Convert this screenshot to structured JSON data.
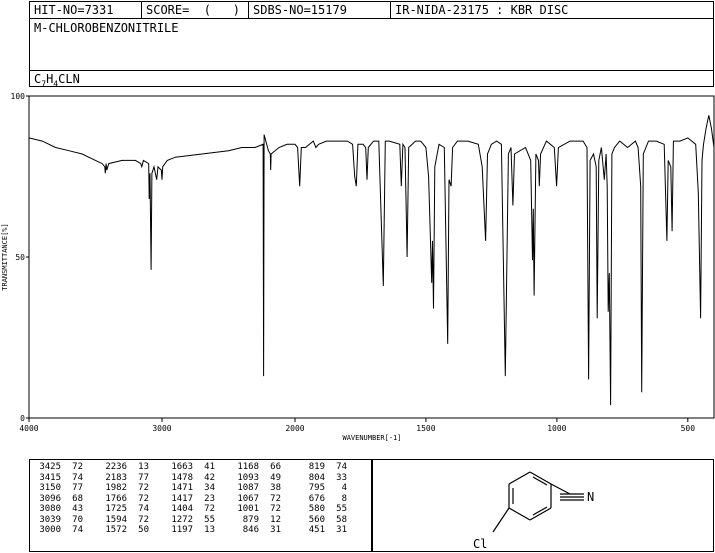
{
  "header": {
    "hit_no": "HIT-NO=7331",
    "score": "SCORE=  (   )",
    "sdbs_no": "SDBS-NO=15179",
    "ir_info": "IR-NIDA-23175 : KBR DISC",
    "compound_name": "M-CHLOROBENZONITRILE",
    "formula": {
      "c": "C",
      "c_sub": "7",
      "h": "H",
      "h_sub": "4",
      "rest": "CLN"
    }
  },
  "chart_data": {
    "type": "line",
    "xlabel": "WAVENUMBER[-1]",
    "ylabel": "TRANSMITTANCE[%]",
    "xlim": [
      4000,
      400
    ],
    "ylim": [
      0,
      100
    ],
    "x_ticks": [
      "4000",
      "3000",
      "2000",
      "1500",
      "1000",
      "500"
    ],
    "y_ticks": [
      "100",
      "50",
      "0"
    ],
    "series": [
      {
        "points": [
          [
            4000,
            87
          ],
          [
            3900,
            86
          ],
          [
            3800,
            84
          ],
          [
            3700,
            83
          ],
          [
            3600,
            82
          ],
          [
            3500,
            80
          ],
          [
            3450,
            79
          ],
          [
            3430,
            78
          ],
          [
            3426,
            76
          ],
          [
            3420,
            79
          ],
          [
            3415,
            77
          ],
          [
            3400,
            79
          ],
          [
            3300,
            80
          ],
          [
            3200,
            80
          ],
          [
            3160,
            79
          ],
          [
            3152,
            78
          ],
          [
            3140,
            80
          ],
          [
            3100,
            79
          ],
          [
            3096,
            68
          ],
          [
            3090,
            76
          ],
          [
            3082,
            46
          ],
          [
            3076,
            76
          ],
          [
            3060,
            78
          ],
          [
            3040,
            74
          ],
          [
            3030,
            78
          ],
          [
            3005,
            77
          ],
          [
            3000,
            74
          ],
          [
            2995,
            78
          ],
          [
            2960,
            80
          ],
          [
            2900,
            81
          ],
          [
            2700,
            82
          ],
          [
            2500,
            83
          ],
          [
            2400,
            84
          ],
          [
            2300,
            84
          ],
          [
            2240,
            85
          ],
          [
            2236,
            13
          ],
          [
            2232,
            88
          ],
          [
            2200,
            83
          ],
          [
            2186,
            82
          ],
          [
            2183,
            77
          ],
          [
            2180,
            82
          ],
          [
            2120,
            84
          ],
          [
            2060,
            85
          ],
          [
            2000,
            85
          ],
          [
            1990,
            84
          ],
          [
            1982,
            72
          ],
          [
            1976,
            84
          ],
          [
            1960,
            84
          ],
          [
            1930,
            86
          ],
          [
            1920,
            84
          ],
          [
            1910,
            85
          ],
          [
            1880,
            86
          ],
          [
            1850,
            86
          ],
          [
            1800,
            86
          ],
          [
            1780,
            85
          ],
          [
            1772,
            75
          ],
          [
            1766,
            72
          ],
          [
            1760,
            85
          ],
          [
            1740,
            85
          ],
          [
            1730,
            84
          ],
          [
            1725,
            74
          ],
          [
            1720,
            84
          ],
          [
            1700,
            86
          ],
          [
            1680,
            86
          ],
          [
            1663,
            41
          ],
          [
            1655,
            86
          ],
          [
            1640,
            86
          ],
          [
            1600,
            85
          ],
          [
            1594,
            72
          ],
          [
            1588,
            85
          ],
          [
            1580,
            84
          ],
          [
            1572,
            50
          ],
          [
            1566,
            84
          ],
          [
            1540,
            86
          ],
          [
            1520,
            86
          ],
          [
            1500,
            84
          ],
          [
            1490,
            75
          ],
          [
            1478,
            42
          ],
          [
            1475,
            55
          ],
          [
            1471,
            34
          ],
          [
            1466,
            78
          ],
          [
            1450,
            85
          ],
          [
            1430,
            84
          ],
          [
            1417,
            23
          ],
          [
            1412,
            74
          ],
          [
            1404,
            72
          ],
          [
            1398,
            84
          ],
          [
            1380,
            86
          ],
          [
            1340,
            86
          ],
          [
            1300,
            85
          ],
          [
            1285,
            78
          ],
          [
            1272,
            55
          ],
          [
            1265,
            82
          ],
          [
            1250,
            85
          ],
          [
            1230,
            86
          ],
          [
            1212,
            85
          ],
          [
            1197,
            13
          ],
          [
            1185,
            82
          ],
          [
            1175,
            84
          ],
          [
            1168,
            66
          ],
          [
            1162,
            82
          ],
          [
            1120,
            84
          ],
          [
            1100,
            80
          ],
          [
            1093,
            49
          ],
          [
            1090,
            65
          ],
          [
            1087,
            38
          ],
          [
            1080,
            82
          ],
          [
            1070,
            80
          ],
          [
            1067,
            72
          ],
          [
            1062,
            82
          ],
          [
            1040,
            86
          ],
          [
            1010,
            84
          ],
          [
            1001,
            72
          ],
          [
            994,
            84
          ],
          [
            950,
            86
          ],
          [
            900,
            86
          ],
          [
            885,
            84
          ],
          [
            879,
            12
          ],
          [
            873,
            80
          ],
          [
            860,
            82
          ],
          [
            850,
            78
          ],
          [
            846,
            31
          ],
          [
            840,
            80
          ],
          [
            830,
            84
          ],
          [
            819,
            74
          ],
          [
            812,
            82
          ],
          [
            808,
            72
          ],
          [
            804,
            33
          ],
          [
            800,
            45
          ],
          [
            795,
            4
          ],
          [
            790,
            82
          ],
          [
            780,
            84
          ],
          [
            760,
            86
          ],
          [
            730,
            84
          ],
          [
            700,
            86
          ],
          [
            690,
            84
          ],
          [
            680,
            72
          ],
          [
            676,
            8
          ],
          [
            670,
            82
          ],
          [
            650,
            86
          ],
          [
            620,
            86
          ],
          [
            590,
            85
          ],
          [
            580,
            55
          ],
          [
            575,
            80
          ],
          [
            565,
            78
          ],
          [
            560,
            58
          ],
          [
            555,
            86
          ],
          [
            530,
            86
          ],
          [
            500,
            87
          ],
          [
            470,
            85
          ],
          [
            460,
            70
          ],
          [
            451,
            31
          ],
          [
            446,
            80
          ],
          [
            440,
            85
          ],
          [
            430,
            90
          ],
          [
            420,
            94
          ],
          [
            410,
            90
          ],
          [
            400,
            84
          ]
        ]
      }
    ]
  },
  "peaks": [
    [
      [
        "3425",
        "72"
      ],
      [
        "3415",
        "74"
      ],
      [
        "3150",
        "77"
      ],
      [
        "3096",
        "68"
      ],
      [
        "3080",
        "43"
      ],
      [
        "3039",
        "70"
      ],
      [
        "3000",
        "74"
      ]
    ],
    [
      [
        "2236",
        "13"
      ],
      [
        "2183",
        "77"
      ],
      [
        "1982",
        "72"
      ],
      [
        "1766",
        "72"
      ],
      [
        "1725",
        "74"
      ],
      [
        "1594",
        "72"
      ],
      [
        "1572",
        "50"
      ]
    ],
    [
      [
        "1663",
        "41"
      ],
      [
        "1478",
        "42"
      ],
      [
        "1471",
        "34"
      ],
      [
        "1417",
        "23"
      ],
      [
        "1404",
        "72"
      ],
      [
        "1272",
        "55"
      ],
      [
        "1197",
        "13"
      ]
    ],
    [
      [
        "1168",
        "66"
      ],
      [
        "1093",
        "49"
      ],
      [
        "1087",
        "38"
      ],
      [
        "1067",
        "72"
      ],
      [
        "1001",
        "72"
      ],
      [
        "879",
        "12"
      ],
      [
        "846",
        "31"
      ]
    ],
    [
      [
        "819",
        "74"
      ],
      [
        "804",
        "33"
      ],
      [
        "795",
        "4"
      ],
      [
        "676",
        "8"
      ],
      [
        "580",
        "55"
      ],
      [
        "560",
        "58"
      ],
      [
        "451",
        "31"
      ]
    ]
  ],
  "structure": {
    "nitrile_label": "N",
    "chloro_label": "Cl"
  }
}
